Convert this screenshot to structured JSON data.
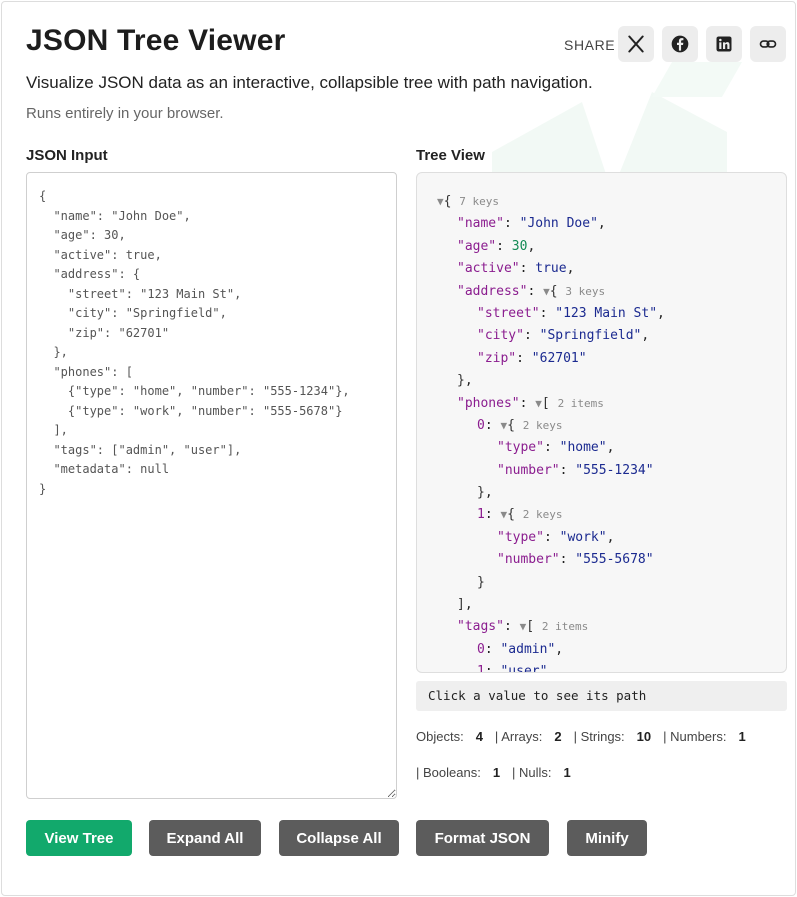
{
  "header": {
    "title": "JSON Tree Viewer",
    "share_label": "SHARE",
    "subtitle": "Visualize JSON data as an interactive, collapsible tree with path navigation.",
    "note": "Runs entirely in your browser."
  },
  "share_buttons": [
    "x-icon",
    "facebook-icon",
    "linkedin-icon",
    "link-icon"
  ],
  "input": {
    "label": "JSON Input",
    "value": "{\n  \"name\": \"John Doe\",\n  \"age\": 30,\n  \"active\": true,\n  \"address\": {\n    \"street\": \"123 Main St\",\n    \"city\": \"Springfield\",\n    \"zip\": \"62701\"\n  },\n  \"phones\": [\n    {\"type\": \"home\", \"number\": \"555-1234\"},\n    {\"type\": \"work\", \"number\": \"555-5678\"}\n  ],\n  \"tags\": [\"admin\", \"user\"],\n  \"metadata\": null\n}"
  },
  "tree": {
    "label": "Tree View",
    "toggle_glyph": "▼",
    "lines": [
      {
        "depth": 0,
        "open": "{",
        "count": "7 keys"
      },
      {
        "depth": 1,
        "key": "\"name\"",
        "value": "\"John Doe\"",
        "vtype": "s",
        "comma": true
      },
      {
        "depth": 1,
        "key": "\"age\"",
        "value": "30",
        "vtype": "n",
        "comma": true
      },
      {
        "depth": 1,
        "key": "\"active\"",
        "value": "true",
        "vtype": "b",
        "comma": true
      },
      {
        "depth": 1,
        "key": "\"address\"",
        "open": "{",
        "count": "3 keys"
      },
      {
        "depth": 2,
        "key": "\"street\"",
        "value": "\"123 Main St\"",
        "vtype": "s",
        "comma": true
      },
      {
        "depth": 2,
        "key": "\"city\"",
        "value": "\"Springfield\"",
        "vtype": "s",
        "comma": true
      },
      {
        "depth": 2,
        "key": "\"zip\"",
        "value": "\"62701\"",
        "vtype": "s"
      },
      {
        "depth": 1,
        "close": "}",
        "comma": true
      },
      {
        "depth": 1,
        "key": "\"phones\"",
        "open": "[",
        "count": "2 items"
      },
      {
        "depth": 2,
        "index": "0",
        "open": "{",
        "count": "2 keys"
      },
      {
        "depth": 3,
        "key": "\"type\"",
        "value": "\"home\"",
        "vtype": "s",
        "comma": true
      },
      {
        "depth": 3,
        "key": "\"number\"",
        "value": "\"555-1234\"",
        "vtype": "s"
      },
      {
        "depth": 2,
        "close": "}",
        "comma": true
      },
      {
        "depth": 2,
        "index": "1",
        "open": "{",
        "count": "2 keys"
      },
      {
        "depth": 3,
        "key": "\"type\"",
        "value": "\"work\"",
        "vtype": "s",
        "comma": true
      },
      {
        "depth": 3,
        "key": "\"number\"",
        "value": "\"555-5678\"",
        "vtype": "s"
      },
      {
        "depth": 2,
        "close": "}"
      },
      {
        "depth": 1,
        "close": "]",
        "comma": true
      },
      {
        "depth": 1,
        "key": "\"tags\"",
        "open": "[",
        "count": "2 items"
      },
      {
        "depth": 2,
        "index": "0",
        "value": "\"admin\"",
        "vtype": "s",
        "comma": true
      },
      {
        "depth": 2,
        "index": "1",
        "value": "\"user\"",
        "vtype": "s"
      }
    ]
  },
  "path_hint": "Click a value to see its path",
  "stats_row1": [
    {
      "label": "Objects:",
      "value": "4"
    },
    {
      "label": "| Arrays:",
      "value": "2"
    },
    {
      "label": "| Strings:",
      "value": "10"
    },
    {
      "label": "| Numbers:",
      "value": "1"
    }
  ],
  "stats_row2": [
    {
      "label": "| Booleans:",
      "value": "1"
    },
    {
      "label": "| Nulls:",
      "value": "1"
    }
  ],
  "buttons": {
    "view_tree": "View Tree",
    "expand_all": "Expand All",
    "collapse_all": "Collapse All",
    "format_json": "Format JSON",
    "minify": "Minify"
  },
  "colors": {
    "primary": "#12a96c",
    "secondary_button": "#5c5c5c",
    "key": "#8b1d8f",
    "string": "#1b2a90",
    "number": "#138a54"
  }
}
